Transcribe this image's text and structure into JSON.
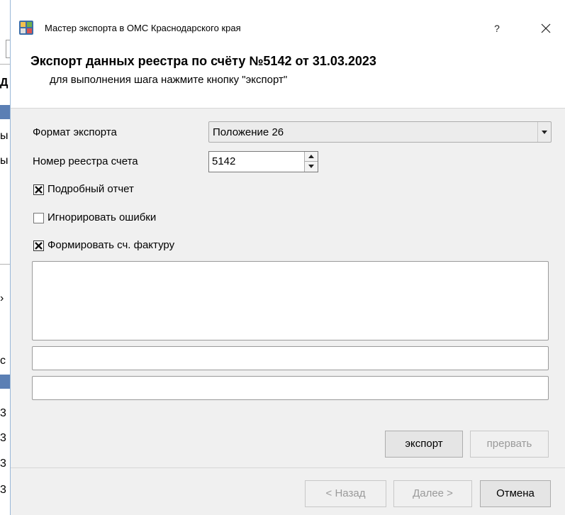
{
  "window": {
    "title": "Мастер экспорта в ОМС Краснодарского края",
    "help_label": "?",
    "close_icon": "close-icon"
  },
  "header": {
    "title": "Экспорт данных реестра по счёту №5142 от 31.03.2023",
    "subtitle": "для выполнения шага нажмите кнопку \"экспорт\""
  },
  "form": {
    "export_format_label": "Формат экспорта",
    "export_format_value": "Положение 26",
    "register_number_label": "Номер реестра счета",
    "register_number_value": "5142"
  },
  "options": {
    "detailed_report": {
      "label": "Подробный отчет",
      "checked": true
    },
    "ignore_errors": {
      "label": "Игнорировать ошибки",
      "checked": false
    },
    "create_invoice": {
      "label": "Формировать сч. фактуру",
      "checked": true
    }
  },
  "log": {
    "memo_text": "",
    "field1_value": "",
    "field2_value": ""
  },
  "actions": {
    "export_label": "экспорт",
    "abort_label": "прервать"
  },
  "navigation": {
    "back_label": "< Назад",
    "next_label": "Далее >",
    "cancel_label": "Отмена"
  },
  "colors": {
    "dialog_bg": "#f0f0f0",
    "header_bg": "#ffffff",
    "disabled_text": "#9a9a9a"
  }
}
